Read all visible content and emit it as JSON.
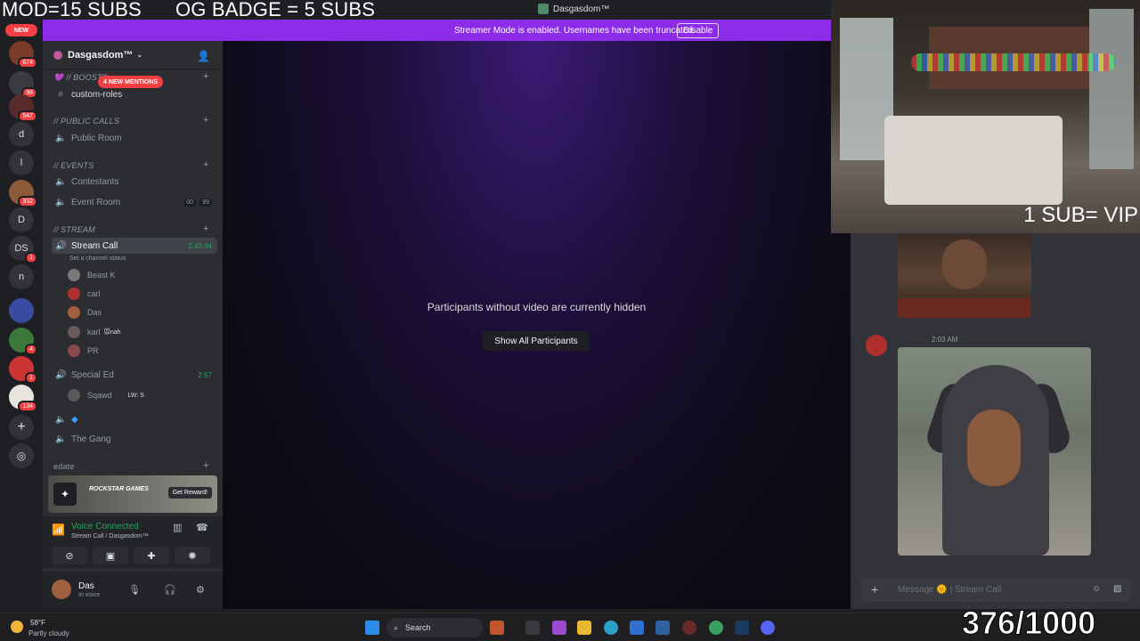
{
  "overlay": {
    "mod_text": "MOD=15 SUBS",
    "badge_text": "OG BADGE = 5 SUBS",
    "vip_text": "1 SUB= VIP",
    "sub_count": "376/1000"
  },
  "window": {
    "title": "Dasgasdom™"
  },
  "banner": {
    "text": "Streamer Mode is enabled. Usernames have been truncated.",
    "button": "Disable"
  },
  "rail": {
    "new_label": "NEW",
    "items": [
      {
        "label": "",
        "badge": "674"
      },
      {
        "label": "",
        "badge": "98"
      },
      {
        "label": "",
        "badge": "547"
      },
      {
        "label": "d",
        "badge": ""
      },
      {
        "label": "l",
        "badge": ""
      },
      {
        "label": "",
        "badge": "332"
      },
      {
        "label": "D",
        "badge": ""
      },
      {
        "label": "DS",
        "badge": "1"
      },
      {
        "label": "n",
        "badge": ""
      },
      {
        "label": "",
        "badge": ""
      },
      {
        "label": "",
        "badge": "4"
      },
      {
        "label": "",
        "badge": "1"
      },
      {
        "label": "",
        "badge": "134"
      }
    ]
  },
  "server": {
    "name": "Dasgasdom™",
    "mentions": "4 NEW MENTIONS",
    "categories": {
      "boost": "💜 // Booste",
      "public": "// PUBLIC CALLS",
      "events": "// Events",
      "stream": "// STREAM",
      "edate": "edate"
    },
    "channels": {
      "custom_roles": "custom-roles",
      "public_room": "Public Room",
      "contestants": "Contestants",
      "event_room": "Event Room",
      "event_room_count_a": "00",
      "event_room_count_b": "99",
      "stream_call": "Stream Call",
      "stream_call_time": "2:43:44",
      "stream_status": "Set a channel status",
      "special_ed": "Special Ed",
      "special_ed_time": "2:57",
      "the_gang": "The Gang"
    },
    "users": [
      {
        "name": "Beast K",
        "extra": ""
      },
      {
        "name": "carl",
        "extra": ""
      },
      {
        "name": "Das",
        "extra": ""
      },
      {
        "name": "karl",
        "extra": "🐭nah"
      },
      {
        "name": "PR",
        "extra": ""
      }
    ],
    "sqawd": {
      "name": "Sqawd",
      "extra": "LW: S"
    }
  },
  "promo": {
    "brand": "ROCKSTAR GAMES",
    "button": "Get Reward!"
  },
  "voice": {
    "status": "Voice Connected",
    "sub": "Stream Call / Dasgasdom™"
  },
  "userbar": {
    "name": "Das",
    "status": "In voice"
  },
  "main": {
    "message": "Participants without video are currently hidden",
    "button": "Show All Participants"
  },
  "chat": {
    "time": "2:03 AM",
    "placeholder": "Message 🌞 | Stream Call"
  },
  "taskbar": {
    "temp": "58°F",
    "weather": "Partly cloudy",
    "search": "Search"
  }
}
